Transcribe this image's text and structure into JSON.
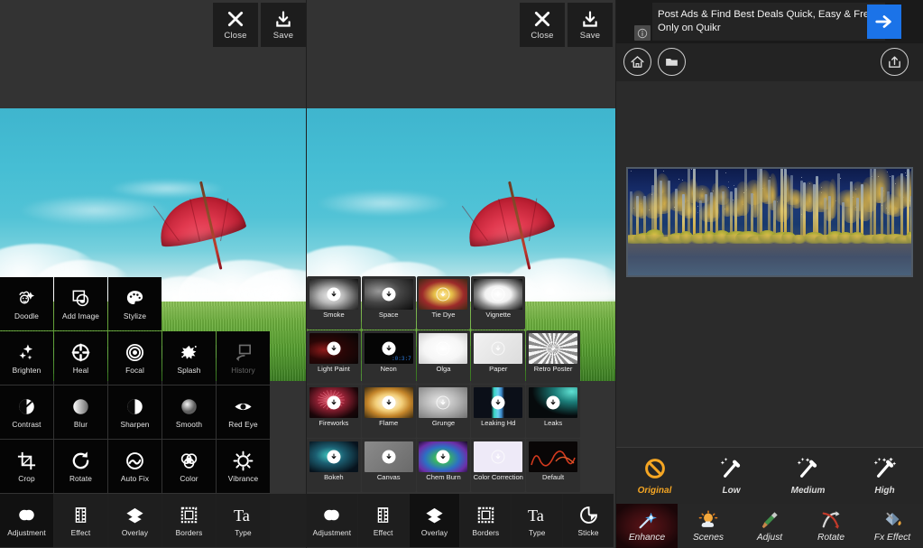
{
  "panels": {
    "left": {
      "name": "photo-editor-tools",
      "topbar": {
        "close_label": "Close",
        "save_label": "Save"
      },
      "photo": {
        "subject": "red umbrella floating over sky, clouds and grass field"
      },
      "tool_rows": [
        [
          {
            "label": "Doodle",
            "icon": "doodle-icon",
            "state": "normal"
          },
          {
            "label": "Add Image",
            "icon": "add-image-icon",
            "state": "normal"
          },
          {
            "label": "Stylize",
            "icon": "palette-icon",
            "state": "normal"
          }
        ],
        [
          {
            "label": "Brighten",
            "icon": "sparkle-icon",
            "state": "normal"
          },
          {
            "label": "Heal",
            "icon": "heal-target-icon",
            "state": "normal"
          },
          {
            "label": "Focal",
            "icon": "focal-rings-icon",
            "state": "normal"
          },
          {
            "label": "Splash",
            "icon": "splash-icon",
            "state": "normal"
          },
          {
            "label": "History",
            "icon": "history-icon",
            "state": "disabled"
          }
        ],
        [
          {
            "label": "Contrast",
            "icon": "contrast-icon",
            "state": "normal"
          },
          {
            "label": "Blur",
            "icon": "blur-icon",
            "state": "normal"
          },
          {
            "label": "Sharpen",
            "icon": "sharpen-icon",
            "state": "normal"
          },
          {
            "label": "Smooth",
            "icon": "smooth-icon",
            "state": "normal"
          },
          {
            "label": "Red Eye",
            "icon": "red-eye-icon",
            "state": "normal"
          }
        ],
        [
          {
            "label": "Crop",
            "icon": "crop-icon",
            "state": "normal"
          },
          {
            "label": "Rotate",
            "icon": "rotate-icon",
            "state": "normal"
          },
          {
            "label": "Auto Fix",
            "icon": "auto-fix-icon",
            "state": "normal"
          },
          {
            "label": "Color",
            "icon": "color-wheel-icon",
            "state": "normal"
          },
          {
            "label": "Vibrance",
            "icon": "vibrance-icon",
            "state": "normal"
          }
        ]
      ],
      "bottom_tabs": [
        {
          "label": "Adjustment",
          "icon": "adjustment-icon",
          "selected": true
        },
        {
          "label": "Effect",
          "icon": "film-strip-icon",
          "selected": false
        },
        {
          "label": "Overlay",
          "icon": "layers-icon",
          "selected": false
        },
        {
          "label": "Borders",
          "icon": "border-frame-icon",
          "selected": false
        },
        {
          "label": "Type",
          "icon": "type-icon",
          "selected": false
        }
      ]
    },
    "middle": {
      "name": "photo-editor-overlays",
      "topbar": {
        "close_label": "Close",
        "save_label": "Save"
      },
      "photo": {
        "subject": "red umbrella floating over sky, clouds and grass field"
      },
      "effect_rows": [
        [
          {
            "label": "Smoke",
            "downloadable": true,
            "thumb": "smoke"
          },
          {
            "label": "Space",
            "downloadable": true,
            "thumb": "space"
          },
          {
            "label": "Tie Dye",
            "downloadable": true,
            "thumb": "tiedye"
          },
          {
            "label": "Vignette",
            "downloadable": true,
            "thumb": "vignette"
          }
        ],
        [
          {
            "label": "Light Paint",
            "downloadable": true,
            "thumb": "lightpaint"
          },
          {
            "label": "Neon",
            "downloadable": true,
            "thumb": "neon"
          },
          {
            "label": "Olga",
            "downloadable": true,
            "thumb": "olga"
          },
          {
            "label": "Paper",
            "downloadable": true,
            "thumb": "paper"
          },
          {
            "label": "Retro Poster",
            "downloadable": true,
            "thumb": "retro"
          }
        ],
        [
          {
            "label": "Fireworks",
            "downloadable": true,
            "thumb": "fireworks"
          },
          {
            "label": "Flame",
            "downloadable": true,
            "thumb": "flame"
          },
          {
            "label": "Grunge",
            "downloadable": true,
            "thumb": "grunge"
          },
          {
            "label": "Leaking Hd",
            "downloadable": true,
            "thumb": "leakinghd"
          },
          {
            "label": "Leaks",
            "downloadable": true,
            "thumb": "leaks"
          }
        ],
        [
          {
            "label": "Bokeh",
            "downloadable": true,
            "thumb": "bokeh"
          },
          {
            "label": "Canvas",
            "downloadable": true,
            "thumb": "canvas"
          },
          {
            "label": "Chem Burn",
            "downloadable": true,
            "thumb": "chemburn"
          },
          {
            "label": "Color Correction",
            "downloadable": true,
            "thumb": "colorcorrection"
          },
          {
            "label": "Default",
            "downloadable": false,
            "thumb": "default"
          }
        ]
      ],
      "bottom_tabs": [
        {
          "label": "Adjustment",
          "icon": "adjustment-icon",
          "selected": false
        },
        {
          "label": "Effect",
          "icon": "film-strip-icon",
          "selected": false
        },
        {
          "label": "Overlay",
          "icon": "layers-icon",
          "selected": true
        },
        {
          "label": "Borders",
          "icon": "border-frame-icon",
          "selected": false
        },
        {
          "label": "Type",
          "icon": "type-icon",
          "selected": false
        },
        {
          "label": "Sticke",
          "icon": "sticker-icon",
          "selected": false
        }
      ]
    },
    "right": {
      "name": "photo-enhancer",
      "ad": {
        "text": "Post Ads & Find Best Deals Quick, Easy & Free Only on Quikr",
        "info_icon": "info-icon",
        "go_icon": "arrow-right-icon"
      },
      "toolbar": [
        {
          "icon": "home-icon",
          "name": "home-button"
        },
        {
          "icon": "folder-icon",
          "name": "gallery-button"
        },
        {
          "icon": "share-icon",
          "name": "share-button"
        }
      ],
      "photo": {
        "subject": "night forest with illuminated trees reflected in a lake"
      },
      "levels": [
        {
          "label": "Original",
          "icon": "no-effect-icon",
          "active": true
        },
        {
          "label": "Low",
          "icon": "magic-wand-low-icon",
          "active": false
        },
        {
          "label": "Medium",
          "icon": "magic-wand-medium-icon",
          "active": false
        },
        {
          "label": "High",
          "icon": "magic-wand-high-icon",
          "active": false
        }
      ],
      "tabs": [
        {
          "label": "Enhance",
          "icon": "magic-wand-icon",
          "active": true
        },
        {
          "label": "Scenes",
          "icon": "sun-cloud-icon",
          "active": false
        },
        {
          "label": "Adjust",
          "icon": "paintbrush-icon",
          "active": false
        },
        {
          "label": "Rotate",
          "icon": "rotate-cross-icon",
          "active": false
        },
        {
          "label": "Fx Effect",
          "icon": "paint-bucket-icon",
          "active": false
        }
      ]
    }
  },
  "colors": {
    "accent_orange": "#F5A623",
    "ad_blue": "#1B73E8",
    "panel_dark": "#333333",
    "tile_black": "#050505"
  }
}
